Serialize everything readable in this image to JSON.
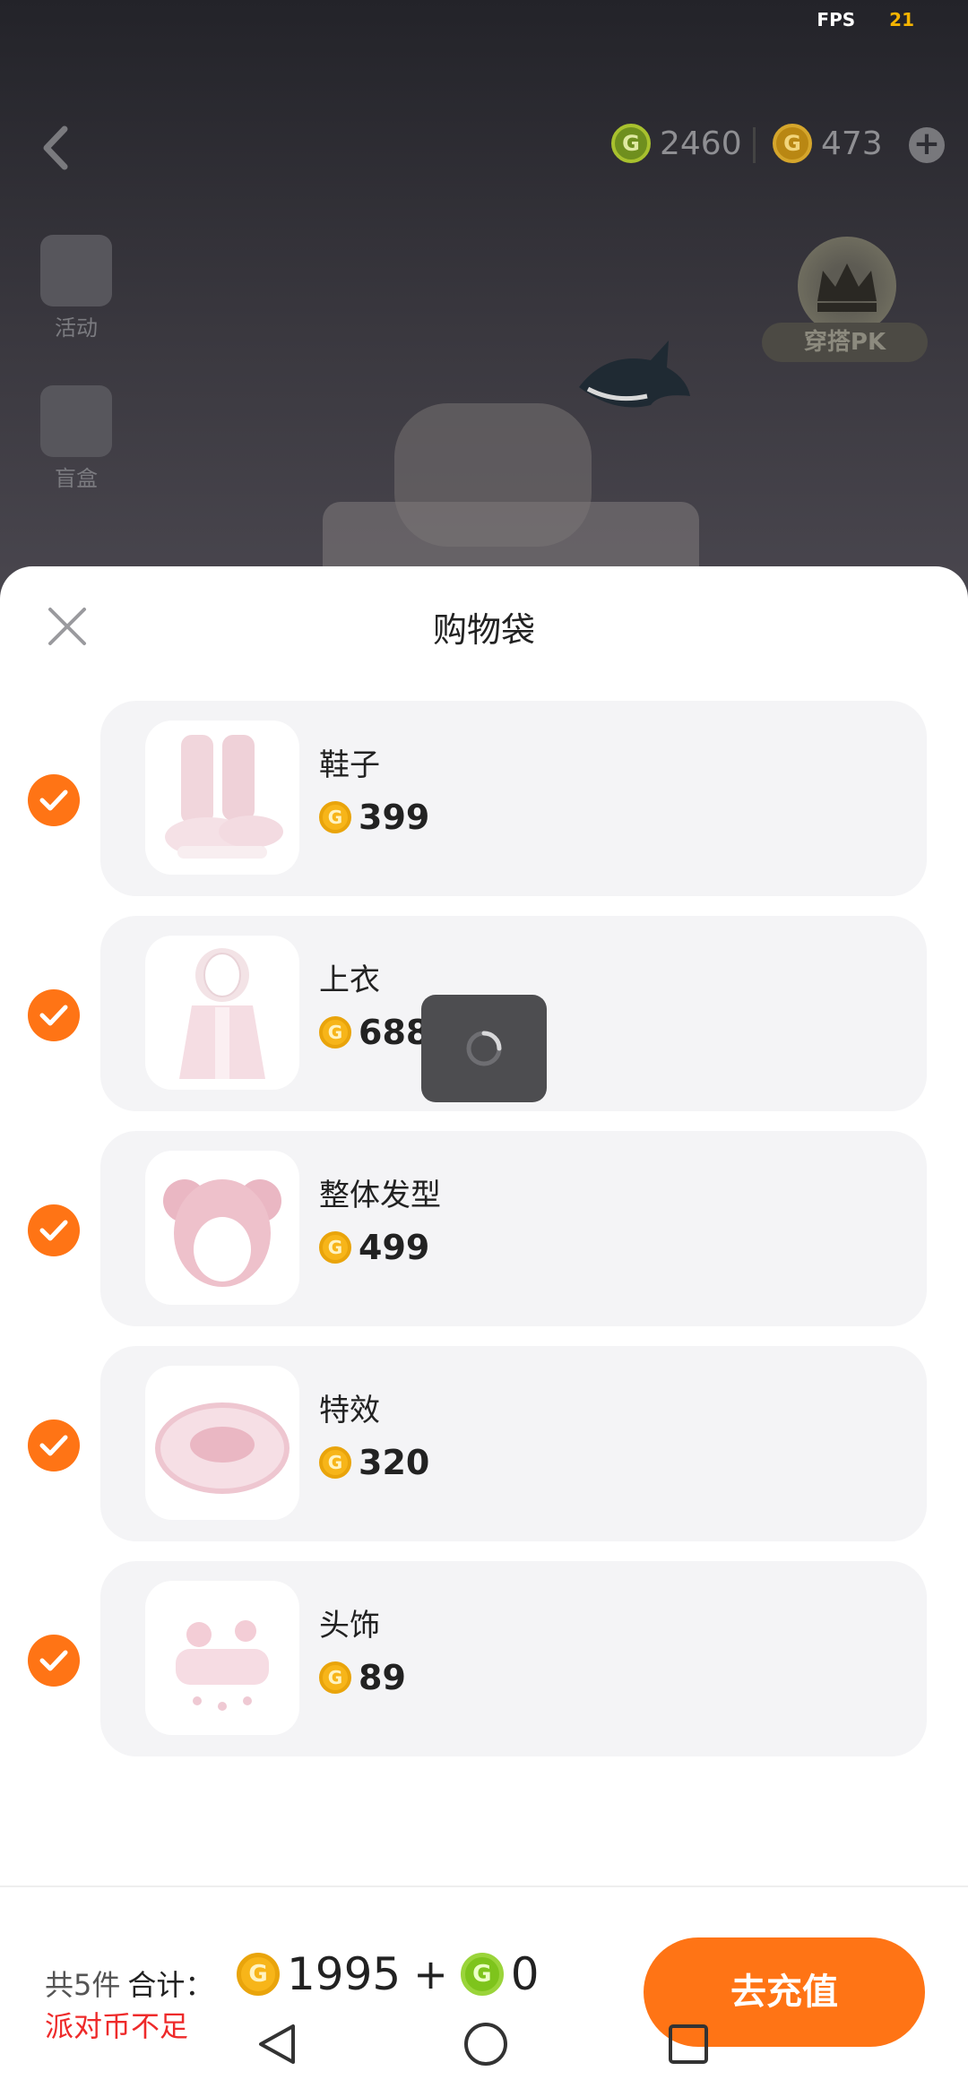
{
  "status": {
    "fps_label": "FPS",
    "fps_value": "21"
  },
  "header": {
    "coin_green": {
      "symbol": "G",
      "value": "2460"
    },
    "coin_orange": {
      "symbol": "G",
      "value": "473"
    },
    "add": "+"
  },
  "side_menu": [
    {
      "label": "活动",
      "icon": "balloon-icon"
    },
    {
      "label": "盲盒",
      "icon": "gift-box-icon"
    }
  ],
  "pk_badge": {
    "label": "穿搭PK"
  },
  "sheet": {
    "title": "购物袋",
    "items": [
      {
        "name": "鞋子",
        "price": "399",
        "checked": true
      },
      {
        "name": "上衣",
        "price": "688",
        "checked": true
      },
      {
        "name": "整体发型",
        "price": "499",
        "checked": true
      },
      {
        "name": "特效",
        "price": "320",
        "checked": true
      },
      {
        "name": "头饰",
        "price": "89",
        "checked": true
      }
    ]
  },
  "footer": {
    "count": "共5件",
    "total_label": "合计：",
    "total_coins": "1995",
    "plus": "+",
    "total_party": "0",
    "warning": "派对币不足",
    "topup_button": "去充值"
  },
  "colors": {
    "accent": "#ff7415",
    "warning": "#ee2a2a",
    "coin_gold": "#f7b519",
    "coin_green": "#7ec41c"
  }
}
